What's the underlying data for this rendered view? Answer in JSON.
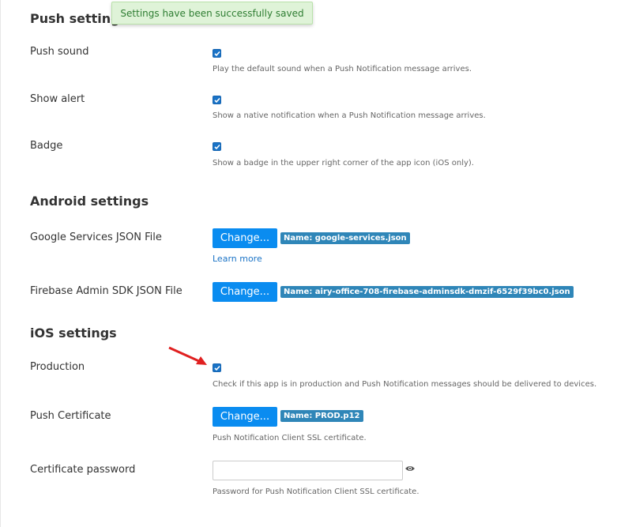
{
  "toast": {
    "message": "Settings have been successfully saved"
  },
  "push": {
    "heading": "Push settings",
    "sound": {
      "label": "Push sound",
      "checked": true,
      "help": "Play the default sound when a Push Notification message arrives."
    },
    "alert": {
      "label": "Show alert",
      "checked": true,
      "help": "Show a native notification when a Push Notification message arrives."
    },
    "badge": {
      "label": "Badge",
      "checked": true,
      "help": "Show a badge in the upper right corner of the app icon (iOS only)."
    }
  },
  "android": {
    "heading": "Android settings",
    "google": {
      "label": "Google Services JSON File",
      "button": "Change...",
      "file": "Name: google-services.json",
      "link": "Learn more"
    },
    "firebase": {
      "label": "Firebase Admin SDK JSON File",
      "button": "Change...",
      "file": "Name: airy-office-708-firebase-adminsdk-dmzif-6529f39bc0.json"
    }
  },
  "ios": {
    "heading": "iOS settings",
    "production": {
      "label": "Production",
      "checked": true,
      "help": "Check if this app is in production and Push Notification messages should be delivered to devices."
    },
    "certificate": {
      "label": "Push Certificate",
      "button": "Change...",
      "file": "Name: PROD.p12",
      "help": "Push Notification Client SSL certificate."
    },
    "password": {
      "label": "Certificate password",
      "value": "",
      "help": "Password for Push Notification Client SSL certificate."
    }
  },
  "colors": {
    "primary_button": "#0a8cf0",
    "file_tag": "#2f86b8",
    "toast_bg": "#dff3d8",
    "annotation_arrow": "#e02020"
  },
  "icons": {
    "checkbox": "checkmark-icon",
    "password_toggle": "eye-icon",
    "annotation": "red-arrow-icon"
  }
}
